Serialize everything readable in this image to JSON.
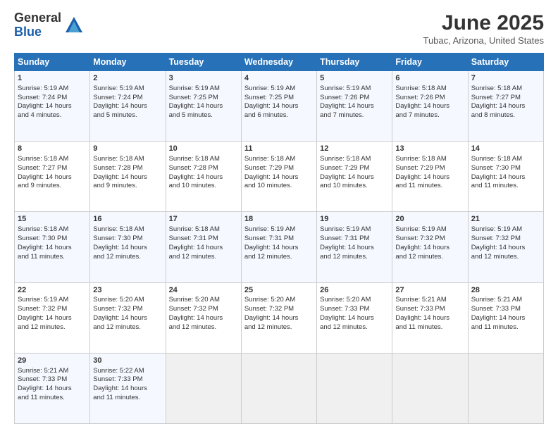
{
  "header": {
    "logo_general": "General",
    "logo_blue": "Blue",
    "month_title": "June 2025",
    "location": "Tubac, Arizona, United States"
  },
  "days_of_week": [
    "Sunday",
    "Monday",
    "Tuesday",
    "Wednesday",
    "Thursday",
    "Friday",
    "Saturday"
  ],
  "weeks": [
    [
      {
        "day": "1",
        "lines": [
          "Sunrise: 5:19 AM",
          "Sunset: 7:24 PM",
          "Daylight: 14 hours",
          "and 4 minutes."
        ]
      },
      {
        "day": "2",
        "lines": [
          "Sunrise: 5:19 AM",
          "Sunset: 7:24 PM",
          "Daylight: 14 hours",
          "and 5 minutes."
        ]
      },
      {
        "day": "3",
        "lines": [
          "Sunrise: 5:19 AM",
          "Sunset: 7:25 PM",
          "Daylight: 14 hours",
          "and 5 minutes."
        ]
      },
      {
        "day": "4",
        "lines": [
          "Sunrise: 5:19 AM",
          "Sunset: 7:25 PM",
          "Daylight: 14 hours",
          "and 6 minutes."
        ]
      },
      {
        "day": "5",
        "lines": [
          "Sunrise: 5:19 AM",
          "Sunset: 7:26 PM",
          "Daylight: 14 hours",
          "and 7 minutes."
        ]
      },
      {
        "day": "6",
        "lines": [
          "Sunrise: 5:18 AM",
          "Sunset: 7:26 PM",
          "Daylight: 14 hours",
          "and 7 minutes."
        ]
      },
      {
        "day": "7",
        "lines": [
          "Sunrise: 5:18 AM",
          "Sunset: 7:27 PM",
          "Daylight: 14 hours",
          "and 8 minutes."
        ]
      }
    ],
    [
      {
        "day": "8",
        "lines": [
          "Sunrise: 5:18 AM",
          "Sunset: 7:27 PM",
          "Daylight: 14 hours",
          "and 9 minutes."
        ]
      },
      {
        "day": "9",
        "lines": [
          "Sunrise: 5:18 AM",
          "Sunset: 7:28 PM",
          "Daylight: 14 hours",
          "and 9 minutes."
        ]
      },
      {
        "day": "10",
        "lines": [
          "Sunrise: 5:18 AM",
          "Sunset: 7:28 PM",
          "Daylight: 14 hours",
          "and 10 minutes."
        ]
      },
      {
        "day": "11",
        "lines": [
          "Sunrise: 5:18 AM",
          "Sunset: 7:29 PM",
          "Daylight: 14 hours",
          "and 10 minutes."
        ]
      },
      {
        "day": "12",
        "lines": [
          "Sunrise: 5:18 AM",
          "Sunset: 7:29 PM",
          "Daylight: 14 hours",
          "and 10 minutes."
        ]
      },
      {
        "day": "13",
        "lines": [
          "Sunrise: 5:18 AM",
          "Sunset: 7:29 PM",
          "Daylight: 14 hours",
          "and 11 minutes."
        ]
      },
      {
        "day": "14",
        "lines": [
          "Sunrise: 5:18 AM",
          "Sunset: 7:30 PM",
          "Daylight: 14 hours",
          "and 11 minutes."
        ]
      }
    ],
    [
      {
        "day": "15",
        "lines": [
          "Sunrise: 5:18 AM",
          "Sunset: 7:30 PM",
          "Daylight: 14 hours",
          "and 11 minutes."
        ]
      },
      {
        "day": "16",
        "lines": [
          "Sunrise: 5:18 AM",
          "Sunset: 7:30 PM",
          "Daylight: 14 hours",
          "and 12 minutes."
        ]
      },
      {
        "day": "17",
        "lines": [
          "Sunrise: 5:18 AM",
          "Sunset: 7:31 PM",
          "Daylight: 14 hours",
          "and 12 minutes."
        ]
      },
      {
        "day": "18",
        "lines": [
          "Sunrise: 5:19 AM",
          "Sunset: 7:31 PM",
          "Daylight: 14 hours",
          "and 12 minutes."
        ]
      },
      {
        "day": "19",
        "lines": [
          "Sunrise: 5:19 AM",
          "Sunset: 7:31 PM",
          "Daylight: 14 hours",
          "and 12 minutes."
        ]
      },
      {
        "day": "20",
        "lines": [
          "Sunrise: 5:19 AM",
          "Sunset: 7:32 PM",
          "Daylight: 14 hours",
          "and 12 minutes."
        ]
      },
      {
        "day": "21",
        "lines": [
          "Sunrise: 5:19 AM",
          "Sunset: 7:32 PM",
          "Daylight: 14 hours",
          "and 12 minutes."
        ]
      }
    ],
    [
      {
        "day": "22",
        "lines": [
          "Sunrise: 5:19 AM",
          "Sunset: 7:32 PM",
          "Daylight: 14 hours",
          "and 12 minutes."
        ]
      },
      {
        "day": "23",
        "lines": [
          "Sunrise: 5:20 AM",
          "Sunset: 7:32 PM",
          "Daylight: 14 hours",
          "and 12 minutes."
        ]
      },
      {
        "day": "24",
        "lines": [
          "Sunrise: 5:20 AM",
          "Sunset: 7:32 PM",
          "Daylight: 14 hours",
          "and 12 minutes."
        ]
      },
      {
        "day": "25",
        "lines": [
          "Sunrise: 5:20 AM",
          "Sunset: 7:32 PM",
          "Daylight: 14 hours",
          "and 12 minutes."
        ]
      },
      {
        "day": "26",
        "lines": [
          "Sunrise: 5:20 AM",
          "Sunset: 7:33 PM",
          "Daylight: 14 hours",
          "and 12 minutes."
        ]
      },
      {
        "day": "27",
        "lines": [
          "Sunrise: 5:21 AM",
          "Sunset: 7:33 PM",
          "Daylight: 14 hours",
          "and 11 minutes."
        ]
      },
      {
        "day": "28",
        "lines": [
          "Sunrise: 5:21 AM",
          "Sunset: 7:33 PM",
          "Daylight: 14 hours",
          "and 11 minutes."
        ]
      }
    ],
    [
      {
        "day": "29",
        "lines": [
          "Sunrise: 5:21 AM",
          "Sunset: 7:33 PM",
          "Daylight: 14 hours",
          "and 11 minutes."
        ]
      },
      {
        "day": "30",
        "lines": [
          "Sunrise: 5:22 AM",
          "Sunset: 7:33 PM",
          "Daylight: 14 hours",
          "and 11 minutes."
        ]
      },
      {
        "day": "",
        "lines": []
      },
      {
        "day": "",
        "lines": []
      },
      {
        "day": "",
        "lines": []
      },
      {
        "day": "",
        "lines": []
      },
      {
        "day": "",
        "lines": []
      }
    ]
  ]
}
